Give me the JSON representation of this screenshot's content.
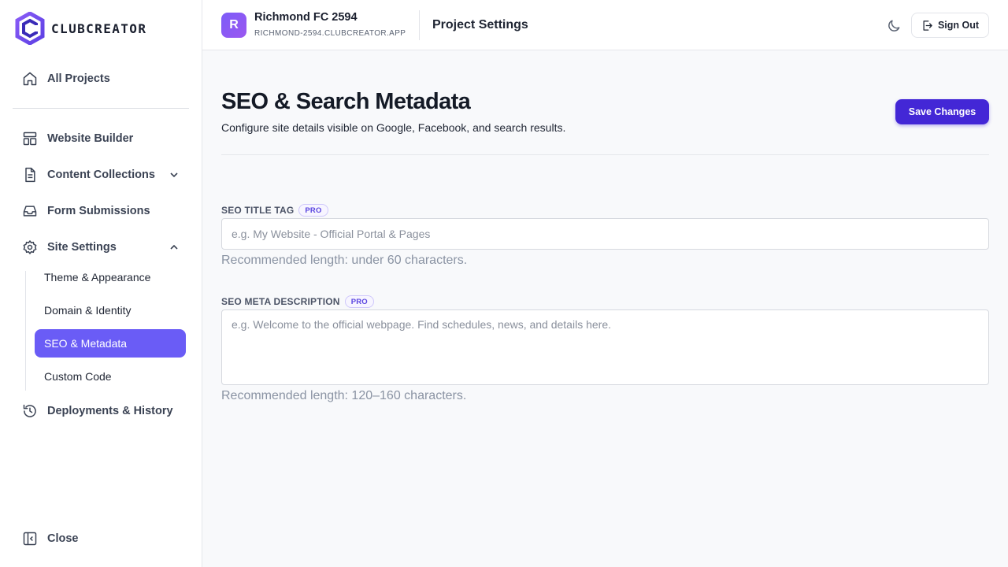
{
  "brand": {
    "name": "CLUBCREATOR",
    "primary_color": "#6a5cf6",
    "logo_icon": "hexagon-logo-icon"
  },
  "sidebar": {
    "all_projects": {
      "label": "All Projects",
      "icon": "home-icon"
    },
    "items": [
      {
        "label": "Website Builder",
        "icon": "layout-icon"
      },
      {
        "label": "Content Collections",
        "icon": "document-icon",
        "expanded": false
      },
      {
        "label": "Form Submissions",
        "icon": "inbox-icon"
      },
      {
        "label": "Site Settings",
        "icon": "gear-icon",
        "expanded": true
      },
      {
        "label": "Deployments & History",
        "icon": "history-icon"
      }
    ],
    "site_settings_sub": [
      {
        "label": "Theme & Appearance",
        "active": false
      },
      {
        "label": "Domain & Identity",
        "active": false
      },
      {
        "label": "SEO & Metadata",
        "active": true
      },
      {
        "label": "Custom Code",
        "active": false
      }
    ],
    "close_label": "Close"
  },
  "header": {
    "avatar_letter": "R",
    "project_name": "Richmond FC 2594",
    "project_domain": "RICHMOND-2594.CLUBCREATOR.APP",
    "section_title": "Project Settings",
    "theme_toggle_icon": "moon-icon",
    "sign_out_label": "Sign Out"
  },
  "main": {
    "title": "SEO & Search Metadata",
    "subtitle": "Configure site details visible on Google, Facebook, and search results.",
    "save_label": "Save Changes",
    "fields": {
      "title_tag": {
        "label": "SEO TITLE TAG",
        "badge": "PRO",
        "value": "",
        "placeholder": "e.g. My Website - Official Portal & Pages",
        "help": "Recommended length: under 60 characters."
      },
      "meta_description": {
        "label": "SEO META DESCRIPTION",
        "badge": "PRO",
        "value": "",
        "placeholder": "e.g. Welcome to the official webpage. Find schedules, news, and details here.",
        "help": "Recommended length: 120–160 characters."
      }
    }
  }
}
